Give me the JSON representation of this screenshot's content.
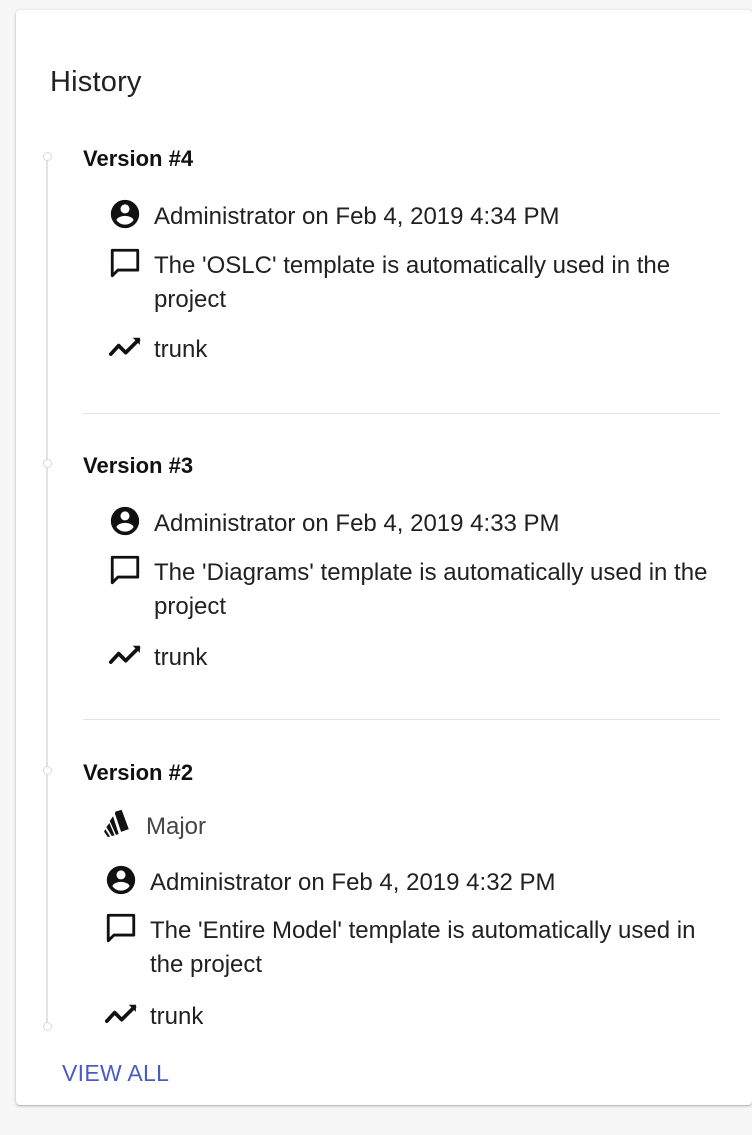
{
  "history": {
    "title": "History",
    "view_all_label": "VIEW ALL",
    "accent_color": "#4a5cc4",
    "versions": [
      {
        "title": "Version #4",
        "author_line": "Administrator on Feb 4, 2019 4:34 PM",
        "comment": "The 'OSLC' template is automatically used in the project",
        "branch": "trunk"
      },
      {
        "title": "Version #3",
        "author_line": "Administrator on Feb 4, 2019 4:33 PM",
        "comment": "The 'Diagrams' template is automatically used in the project",
        "branch": "trunk"
      },
      {
        "title": "Version #2",
        "tag": "Major",
        "author_line": "Administrator on Feb 4, 2019 4:32 PM",
        "comment": "The 'Entire Model' template is automatically used in the project",
        "branch": "trunk"
      }
    ]
  },
  "icons": {
    "author": "account-circle-icon",
    "comment": "comment-icon",
    "branch": "branch-trend-icon",
    "tag": "tag-cards-icon"
  }
}
